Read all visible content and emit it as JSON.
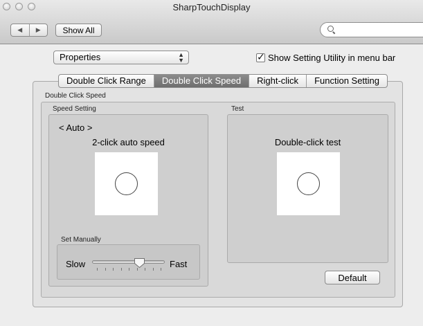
{
  "window": {
    "title": "SharpTouchDisplay"
  },
  "toolbar": {
    "back_icon": "◀",
    "forward_icon": "▶",
    "show_all_label": "Show All",
    "search": {
      "value": "",
      "placeholder": ""
    }
  },
  "properties_popup": {
    "selected": "Properties",
    "arrow_icon": "⬍"
  },
  "show_utility_checkbox": {
    "label": "Show Setting Utility in menu bar",
    "checked": true
  },
  "tabs": [
    {
      "label": "Double Click Range",
      "active": false
    },
    {
      "label": "Double Click Speed",
      "active": true
    },
    {
      "label": "Right-click",
      "active": false
    },
    {
      "label": "Function Setting",
      "active": false
    }
  ],
  "double_click_speed": {
    "group_label": "Double Click Speed",
    "speed_setting": {
      "label": "Speed Setting",
      "mode": "< Auto >",
      "auto_title": "2-click auto speed"
    },
    "manual": {
      "label": "Set Manually",
      "slow_label": "Slow",
      "fast_label": "Fast",
      "slider_value": 0.68,
      "tick_count": 9
    },
    "test": {
      "label": "Test",
      "title": "Double-click test"
    },
    "default_label": "Default"
  }
}
